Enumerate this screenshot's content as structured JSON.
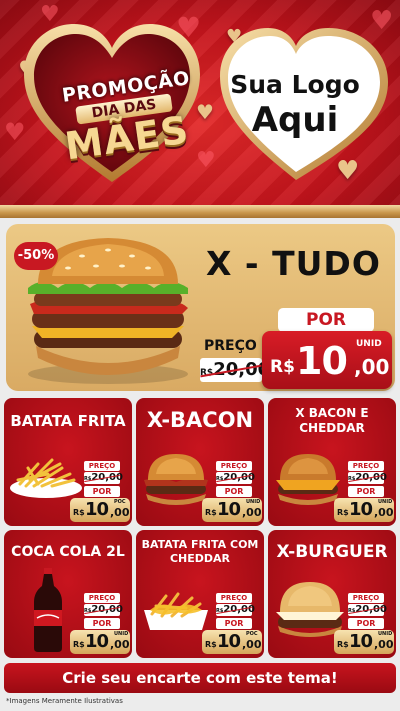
{
  "header": {
    "promo_line1": "PROMOÇÃO",
    "promo_line2": "DIA DAS",
    "promo_line3": "MÃES",
    "logo_line1": "Sua Logo",
    "logo_line2": "Aqui"
  },
  "featured": {
    "discount": "-50%",
    "title": "X - TUDO",
    "old_label": "PREÇO",
    "old_currency": "R$",
    "old_value": "20,00",
    "por_label": "POR",
    "currency": "R$",
    "price_int": "10",
    "price_dec": ",00",
    "unit": "UNID"
  },
  "products": [
    {
      "name": "BATATA FRITA",
      "old_label": "PREÇO",
      "old_currency": "R$",
      "old_value": "20,00",
      "por_label": "POR",
      "currency": "R$",
      "price_int": "10",
      "price_dec": ",00",
      "unit": "POC"
    },
    {
      "name": "X-BACON",
      "old_label": "PREÇO",
      "old_currency": "R$",
      "old_value": "20,00",
      "por_label": "POR",
      "currency": "R$",
      "price_int": "10",
      "price_dec": ",00",
      "unit": "UNID"
    },
    {
      "name": "X BACON E CHEDDAR",
      "old_label": "PREÇO",
      "old_currency": "R$",
      "old_value": "20,00",
      "por_label": "POR",
      "currency": "R$",
      "price_int": "10",
      "price_dec": ",00",
      "unit": "UNID"
    },
    {
      "name": "COCA COLA 2L",
      "old_label": "PREÇO",
      "old_currency": "R$",
      "old_value": "20,00",
      "por_label": "POR",
      "currency": "R$",
      "price_int": "10",
      "price_dec": ",00",
      "unit": "UNID"
    },
    {
      "name": "BATATA FRITA COM CHEDDAR",
      "old_label": "PREÇO",
      "old_currency": "R$",
      "old_value": "20,00",
      "por_label": "POR",
      "currency": "R$",
      "price_int": "10",
      "price_dec": ",00",
      "unit": "POC"
    },
    {
      "name": "X-BURGUER",
      "old_label": "PREÇO",
      "old_currency": "R$",
      "old_value": "20,00",
      "por_label": "POR",
      "currency": "R$",
      "price_int": "10",
      "price_dec": ",00",
      "unit": "UNID"
    }
  ],
  "footer": {
    "cta": "Crie seu encarte com este tema!",
    "disclaimer": "*Imagens Meramente Ilustrativas"
  },
  "colors": {
    "brand_red": "#c81822",
    "gold": "#d9aa63",
    "dark_red": "#980a12"
  },
  "icons": [
    "heart-icon",
    "burger-image",
    "fries-image",
    "soda-bottle-image",
    "cheese-fries-image"
  ]
}
